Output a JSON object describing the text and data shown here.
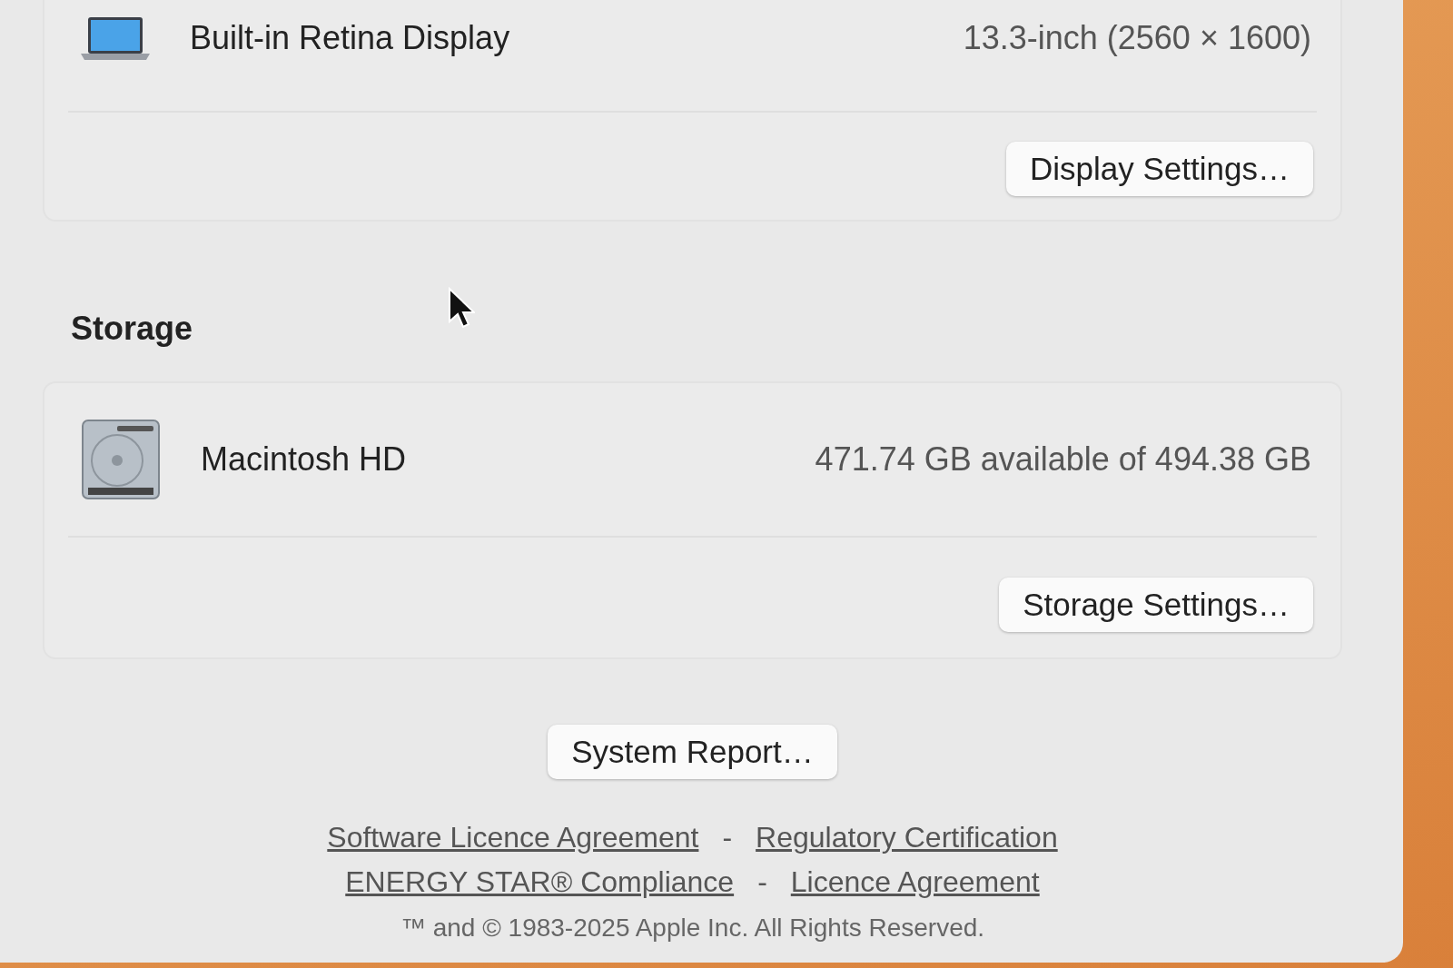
{
  "cards": [
    {
      "kind": "display",
      "name": "Built-in Retina Display",
      "detail": "13.3-inch (2560 × 1600)",
      "button": "Display Settings…"
    },
    {
      "kind": "disk",
      "heading": "Storage",
      "name": "Macintosh HD",
      "detail": "471.74 GB available of 494.38 GB",
      "button": "Storage Settings…"
    }
  ],
  "system_report_button": "System Report…",
  "link_rows": [
    {
      "links": [
        "Software Licence Agreement",
        "Regulatory Certification"
      ],
      "separator": "-"
    },
    {
      "links": [
        "ENERGY STAR® Compliance",
        "Licence Agreement"
      ],
      "separator": "-"
    }
  ],
  "copyright": "™ and © 1983-2025 Apple Inc. All Rights Reserved."
}
